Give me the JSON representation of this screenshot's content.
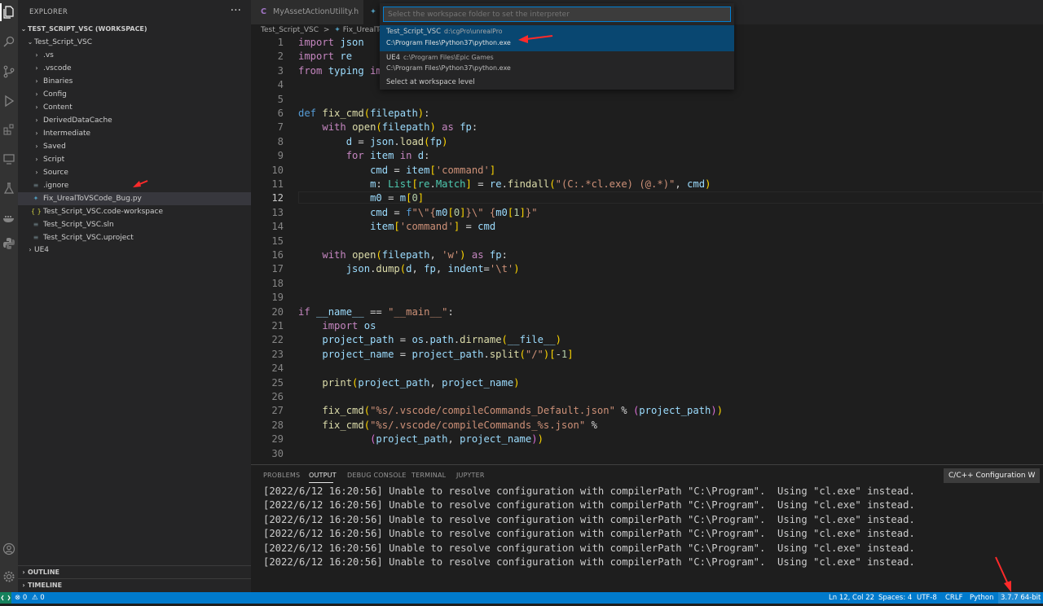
{
  "explorer": {
    "title": "EXPLORER",
    "more": "···",
    "workspace": "TEST_SCRIPT_VSC (WORKSPACE)",
    "root": "Test_Script_VSC",
    "items": [
      {
        "label": ".vs",
        "type": "folder"
      },
      {
        "label": ".vscode",
        "type": "folder"
      },
      {
        "label": "Binaries",
        "type": "folder"
      },
      {
        "label": "Config",
        "type": "folder"
      },
      {
        "label": "Content",
        "type": "folder"
      },
      {
        "label": "DerivedDataCache",
        "type": "folder"
      },
      {
        "label": "Intermediate",
        "type": "folder"
      },
      {
        "label": "Saved",
        "type": "folder"
      },
      {
        "label": "Script",
        "type": "folder"
      },
      {
        "label": "Source",
        "type": "folder"
      },
      {
        "label": ".ignore",
        "type": "file"
      },
      {
        "label": "Fix_UrealToVSCode_Bug.py",
        "type": "file"
      },
      {
        "label": "Test_Script_VSC.code-workspace",
        "type": "file"
      },
      {
        "label": "Test_Script_VSC.sln",
        "type": "file"
      },
      {
        "label": "Test_Script_VSC.uproject",
        "type": "file"
      }
    ],
    "ue4": "UE4",
    "outline": "OUTLINE",
    "timeline": "TIMELINE",
    "workspace_glyph": "{ }"
  },
  "tabs": {
    "tab1_icon": "C",
    "tab1": "MyAssetActionUtility.h"
  },
  "breadcrumb": {
    "folder": "Test_Script_VSC",
    "sep": ">",
    "file": "Fix_UrealToVS"
  },
  "quickpick": {
    "placeholder": "Select the workspace folder to set the interpreter",
    "items": [
      {
        "label": "Test_Script_VSC",
        "desc": "d:\\cgPro\\unrealPro",
        "detail": "C:\\Program Files\\Python37\\python.exe"
      },
      {
        "label": "UE4",
        "desc": "c:\\Program Files\\Epic Games",
        "detail": "C:\\Program Files\\Python37\\python.exe"
      }
    ],
    "workspace_level": "Select at workspace level"
  },
  "editor": {
    "current_line": 12,
    "lines": [
      {
        "n": "1"
      },
      {
        "n": "2"
      },
      {
        "n": "3"
      },
      {
        "n": "4"
      },
      {
        "n": "5"
      },
      {
        "n": "6"
      },
      {
        "n": "7"
      },
      {
        "n": "8"
      },
      {
        "n": "9"
      },
      {
        "n": "10"
      },
      {
        "n": "11"
      },
      {
        "n": "12"
      },
      {
        "n": "13"
      },
      {
        "n": "14"
      },
      {
        "n": "15"
      },
      {
        "n": "16"
      },
      {
        "n": "17"
      },
      {
        "n": "18"
      },
      {
        "n": "19"
      },
      {
        "n": "20"
      },
      {
        "n": "21"
      },
      {
        "n": "22"
      },
      {
        "n": "23"
      },
      {
        "n": "24"
      },
      {
        "n": "25"
      },
      {
        "n": "26"
      },
      {
        "n": "27"
      },
      {
        "n": "28"
      },
      {
        "n": "29"
      },
      {
        "n": "30"
      }
    ],
    "code": [
      [
        [
          "kw",
          "import"
        ],
        [
          "t",
          " "
        ],
        [
          "vr",
          "json"
        ]
      ],
      [
        [
          "kw",
          "import"
        ],
        [
          "t",
          " "
        ],
        [
          "vr",
          "re"
        ]
      ],
      [
        [
          "kw",
          "from"
        ],
        [
          "t",
          " "
        ],
        [
          "vr",
          "typing"
        ],
        [
          "t",
          " "
        ],
        [
          "kw",
          "im"
        ]
      ],
      [],
      [],
      [
        [
          "df",
          "def"
        ],
        [
          "t",
          " "
        ],
        [
          "fn",
          "fix_cmd"
        ],
        [
          "p1",
          "("
        ],
        [
          "vr",
          "filepath"
        ],
        [
          "p1",
          ")"
        ],
        [
          "t",
          ":"
        ]
      ],
      [
        [
          "t",
          "    "
        ],
        [
          "kw",
          "with"
        ],
        [
          "t",
          " "
        ],
        [
          "fn",
          "open"
        ],
        [
          "p1",
          "("
        ],
        [
          "vr",
          "filepath"
        ],
        [
          "p1",
          ")"
        ],
        [
          "t",
          " "
        ],
        [
          "kw",
          "as"
        ],
        [
          "t",
          " "
        ],
        [
          "vr",
          "fp"
        ],
        [
          "t",
          ":"
        ]
      ],
      [
        [
          "t",
          "        "
        ],
        [
          "vr",
          "d"
        ],
        [
          "t",
          " = "
        ],
        [
          "vr",
          "json"
        ],
        [
          "t",
          "."
        ],
        [
          "fn",
          "load"
        ],
        [
          "p1",
          "("
        ],
        [
          "vr",
          "fp"
        ],
        [
          "p1",
          ")"
        ]
      ],
      [
        [
          "t",
          "        "
        ],
        [
          "kw",
          "for"
        ],
        [
          "t",
          " "
        ],
        [
          "vr",
          "item"
        ],
        [
          "t",
          " "
        ],
        [
          "kw",
          "in"
        ],
        [
          "t",
          " "
        ],
        [
          "vr",
          "d"
        ],
        [
          "t",
          ":"
        ]
      ],
      [
        [
          "t",
          "            "
        ],
        [
          "vr",
          "cmd"
        ],
        [
          "t",
          " = "
        ],
        [
          "vr",
          "item"
        ],
        [
          "p1",
          "["
        ],
        [
          "st",
          "'command'"
        ],
        [
          "p1",
          "]"
        ]
      ],
      [
        [
          "t",
          "            "
        ],
        [
          "vr",
          "m"
        ],
        [
          "t",
          ": "
        ],
        [
          "ty",
          "List"
        ],
        [
          "p1",
          "["
        ],
        [
          "ty",
          "re"
        ],
        [
          "t",
          "."
        ],
        [
          "ty",
          "Match"
        ],
        [
          "p1",
          "]"
        ],
        [
          "t",
          " = "
        ],
        [
          "vr",
          "re"
        ],
        [
          "t",
          "."
        ],
        [
          "fn",
          "findall"
        ],
        [
          "p1",
          "("
        ],
        [
          "st",
          "\"(C:.*cl.exe) (@.*)\""
        ],
        [
          "t",
          ", "
        ],
        [
          "vr",
          "cmd"
        ],
        [
          "p1",
          ")"
        ]
      ],
      [
        [
          "t",
          "            "
        ],
        [
          "vr",
          "m0"
        ],
        [
          "t",
          " = "
        ],
        [
          "vr",
          "m"
        ],
        [
          "p1",
          "["
        ],
        [
          "nm",
          "0"
        ],
        [
          "p1",
          "]"
        ]
      ],
      [
        [
          "t",
          "            "
        ],
        [
          "vr",
          "cmd"
        ],
        [
          "t",
          " = "
        ],
        [
          "df",
          "f"
        ],
        [
          "st",
          "\"\\\"{"
        ],
        [
          "vr",
          "m0"
        ],
        [
          "p1",
          "["
        ],
        [
          "nm",
          "0"
        ],
        [
          "p1",
          "]"
        ],
        [
          "st",
          "}\\\" {"
        ],
        [
          "vr",
          "m0"
        ],
        [
          "p1",
          "["
        ],
        [
          "nm",
          "1"
        ],
        [
          "p1",
          "]"
        ],
        [
          "st",
          "}\""
        ]
      ],
      [
        [
          "t",
          "            "
        ],
        [
          "vr",
          "item"
        ],
        [
          "p1",
          "["
        ],
        [
          "st",
          "'command'"
        ],
        [
          "p1",
          "]"
        ],
        [
          "t",
          " = "
        ],
        [
          "vr",
          "cmd"
        ]
      ],
      [],
      [
        [
          "t",
          "    "
        ],
        [
          "kw",
          "with"
        ],
        [
          "t",
          " "
        ],
        [
          "fn",
          "open"
        ],
        [
          "p1",
          "("
        ],
        [
          "vr",
          "filepath"
        ],
        [
          "t",
          ", "
        ],
        [
          "st",
          "'w'"
        ],
        [
          "p1",
          ")"
        ],
        [
          "t",
          " "
        ],
        [
          "kw",
          "as"
        ],
        [
          "t",
          " "
        ],
        [
          "vr",
          "fp"
        ],
        [
          "t",
          ":"
        ]
      ],
      [
        [
          "t",
          "        "
        ],
        [
          "vr",
          "json"
        ],
        [
          "t",
          "."
        ],
        [
          "fn",
          "dump"
        ],
        [
          "p1",
          "("
        ],
        [
          "vr",
          "d"
        ],
        [
          "t",
          ", "
        ],
        [
          "vr",
          "fp"
        ],
        [
          "t",
          ", "
        ],
        [
          "vr",
          "indent"
        ],
        [
          "t",
          "="
        ],
        [
          "st",
          "'\\t'"
        ],
        [
          "p1",
          ")"
        ]
      ],
      [],
      [],
      [
        [
          "kw",
          "if"
        ],
        [
          "t",
          " "
        ],
        [
          "vr",
          "__name__"
        ],
        [
          "t",
          " == "
        ],
        [
          "st",
          "\"__main__\""
        ],
        [
          "t",
          ":"
        ]
      ],
      [
        [
          "t",
          "    "
        ],
        [
          "kw",
          "import"
        ],
        [
          "t",
          " "
        ],
        [
          "vr",
          "os"
        ]
      ],
      [
        [
          "t",
          "    "
        ],
        [
          "vr",
          "project_path"
        ],
        [
          "t",
          " = "
        ],
        [
          "vr",
          "os"
        ],
        [
          "t",
          "."
        ],
        [
          "vr",
          "path"
        ],
        [
          "t",
          "."
        ],
        [
          "fn",
          "dirname"
        ],
        [
          "p1",
          "("
        ],
        [
          "vr",
          "__file__"
        ],
        [
          "p1",
          ")"
        ]
      ],
      [
        [
          "t",
          "    "
        ],
        [
          "vr",
          "project_name"
        ],
        [
          "t",
          " = "
        ],
        [
          "vr",
          "project_path"
        ],
        [
          "t",
          "."
        ],
        [
          "fn",
          "split"
        ],
        [
          "p1",
          "("
        ],
        [
          "st",
          "\"/\""
        ],
        [
          "p1",
          ")"
        ],
        [
          "p1",
          "["
        ],
        [
          "t",
          "-"
        ],
        [
          "nm",
          "1"
        ],
        [
          "p1",
          "]"
        ]
      ],
      [],
      [
        [
          "t",
          "    "
        ],
        [
          "fn",
          "print"
        ],
        [
          "p1",
          "("
        ],
        [
          "vr",
          "project_path"
        ],
        [
          "t",
          ", "
        ],
        [
          "vr",
          "project_name"
        ],
        [
          "p1",
          ")"
        ]
      ],
      [],
      [
        [
          "t",
          "    "
        ],
        [
          "fn",
          "fix_cmd"
        ],
        [
          "p1",
          "("
        ],
        [
          "st",
          "\"%s/.vscode/compileCommands_Default.json\""
        ],
        [
          "t",
          " % "
        ],
        [
          "p2",
          "("
        ],
        [
          "vr",
          "project_path"
        ],
        [
          "p2",
          ")"
        ],
        [
          "p1",
          ")"
        ]
      ],
      [
        [
          "t",
          "    "
        ],
        [
          "fn",
          "fix_cmd"
        ],
        [
          "p1",
          "("
        ],
        [
          "st",
          "\"%s/.vscode/compileCommands_%s.json\""
        ],
        [
          "t",
          " %"
        ]
      ],
      [
        [
          "t",
          "            "
        ],
        [
          "p2",
          "("
        ],
        [
          "vr",
          "project_path"
        ],
        [
          "t",
          ", "
        ],
        [
          "vr",
          "project_name"
        ],
        [
          "p2",
          ")"
        ],
        [
          "p1",
          ")"
        ]
      ],
      []
    ]
  },
  "panel": {
    "tabs": [
      "PROBLEMS",
      "OUTPUT",
      "DEBUG CONSOLE",
      "TERMINAL",
      "JUPYTER"
    ],
    "active": "OUTPUT",
    "channel": "C/C++ Configuration W",
    "lines": [
      "[2022/6/12 16:20:56] Unable to resolve configuration with compilerPath \"C:\\Program\".  Using \"cl.exe\" instead.",
      "[2022/6/12 16:20:56] Unable to resolve configuration with compilerPath \"C:\\Program\".  Using \"cl.exe\" instead.",
      "[2022/6/12 16:20:56] Unable to resolve configuration with compilerPath \"C:\\Program\".  Using \"cl.exe\" instead.",
      "[2022/6/12 16:20:56] Unable to resolve configuration with compilerPath \"C:\\Program\".  Using \"cl.exe\" instead.",
      "[2022/6/12 16:20:56] Unable to resolve configuration with compilerPath \"C:\\Program\".  Using \"cl.exe\" instead.",
      "[2022/6/12 16:20:56] Unable to resolve configuration with compilerPath \"C:\\Program\".  Using \"cl.exe\" instead."
    ]
  },
  "status": {
    "errors": "0",
    "warnings": "0",
    "position": "Ln 12, Col 22",
    "spaces": "Spaces: 4",
    "encoding": "UTF-8",
    "eol": "CRLF",
    "language": "Python",
    "interpreter": "3.7.7 64-bit"
  },
  "colors": {
    "accent": "#007acc",
    "selection": "#094771",
    "annotation_arrow": "#ff2a2a"
  }
}
